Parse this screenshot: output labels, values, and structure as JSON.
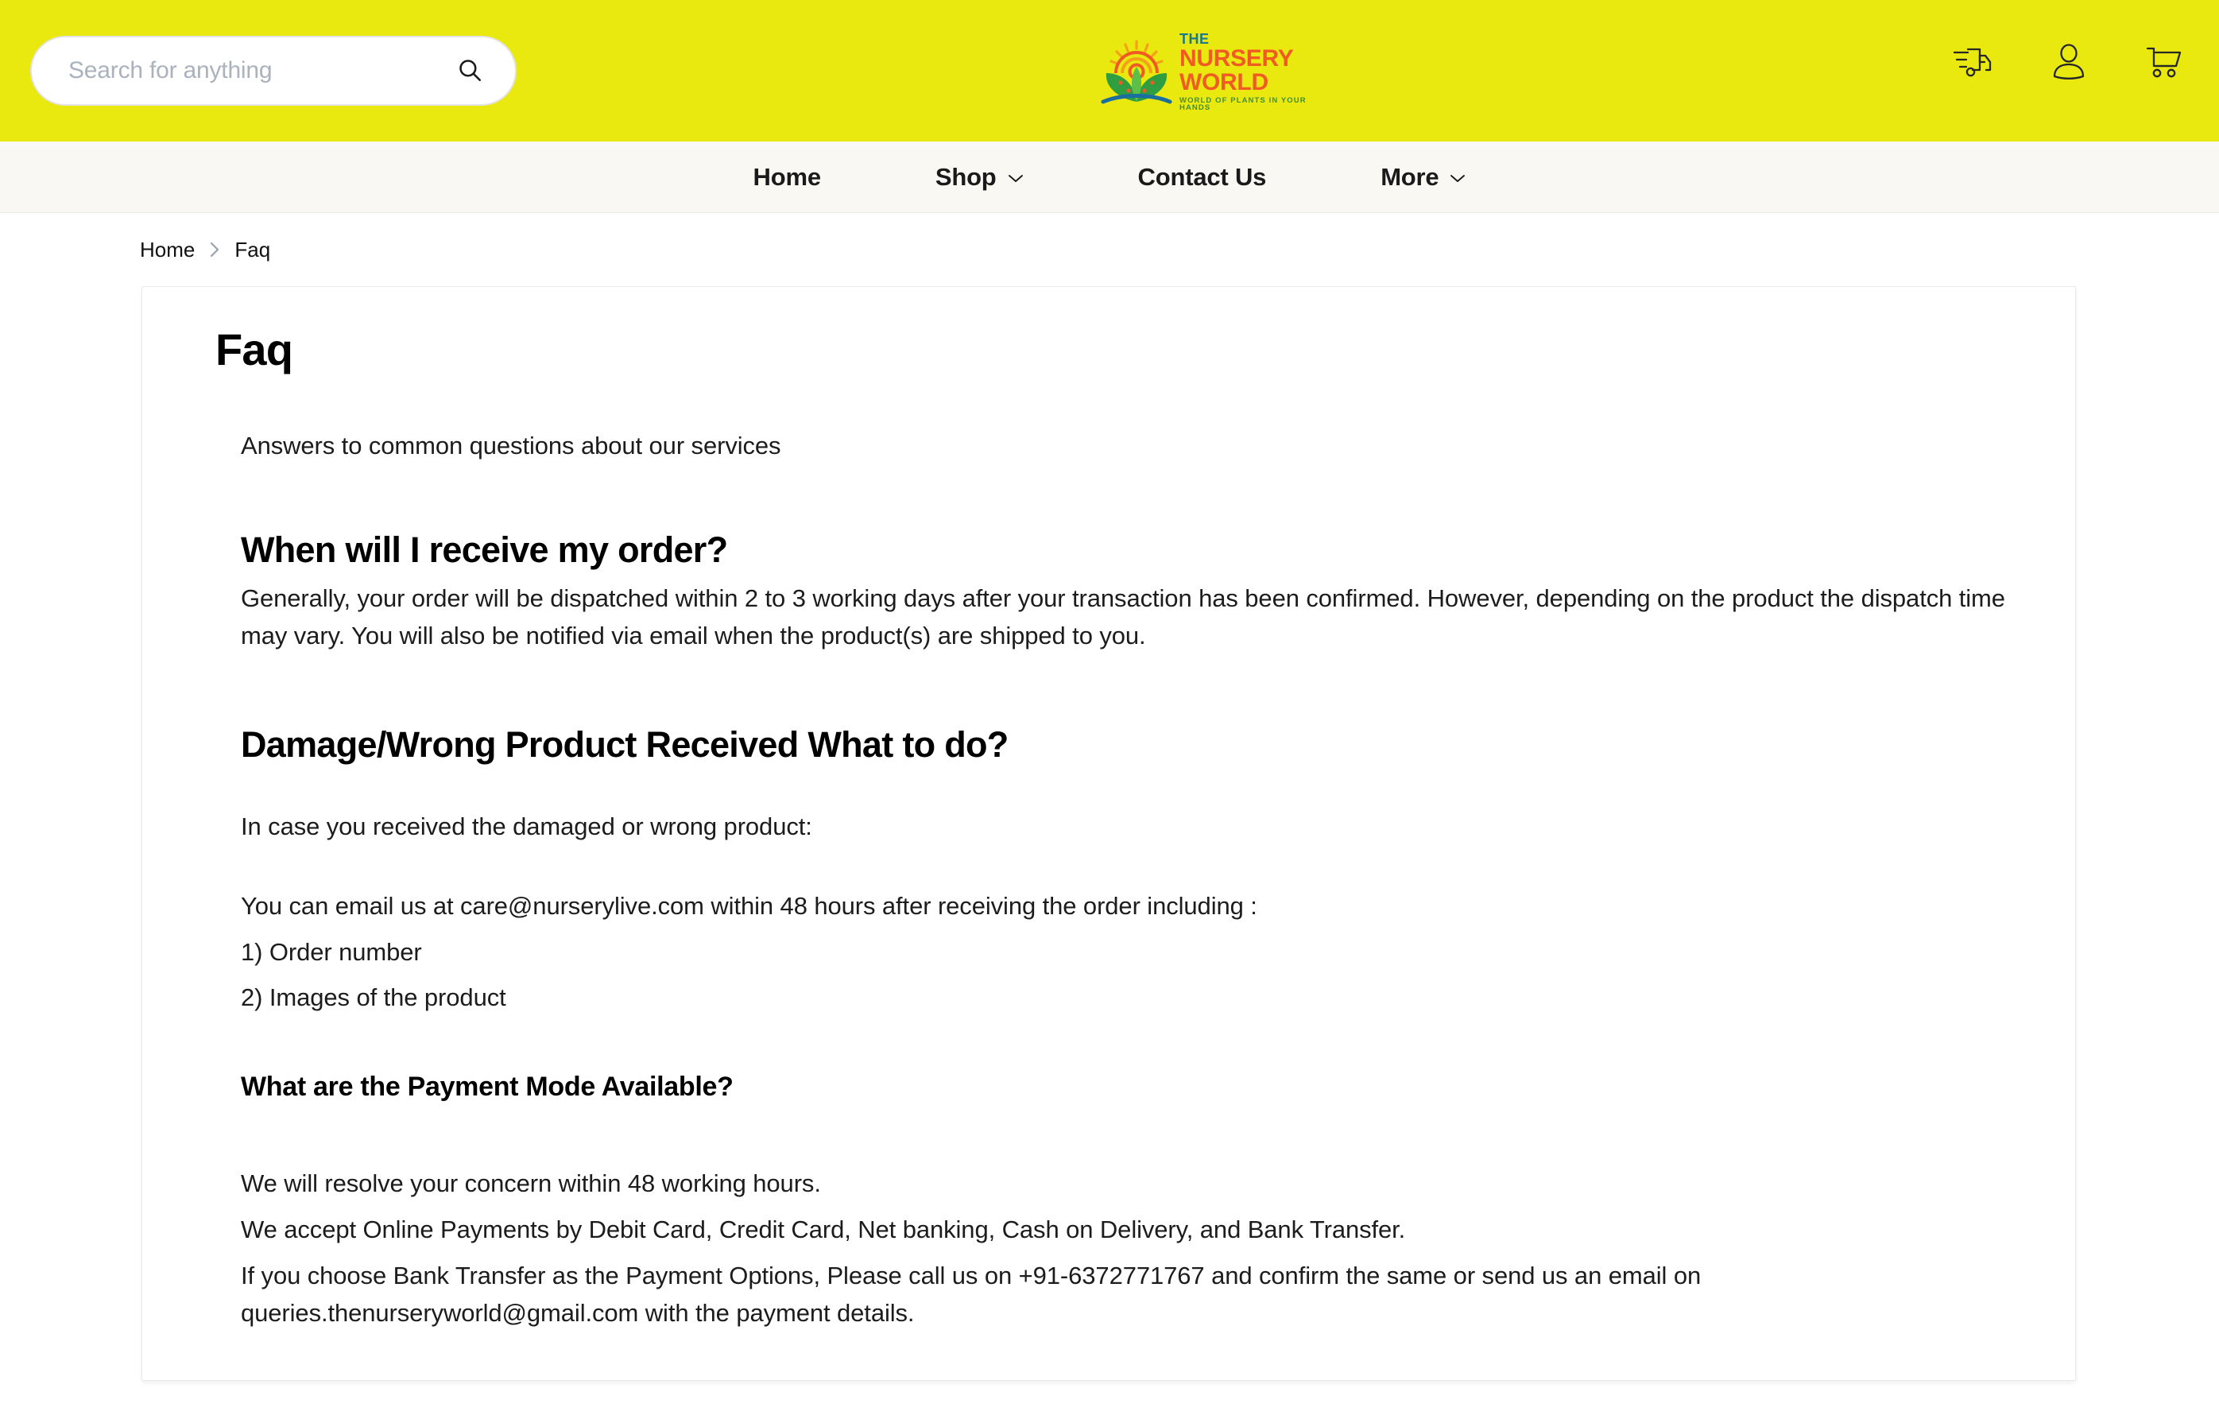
{
  "colors": {
    "header_yellow": "#e9e80f",
    "nav_background": "#f9f8f3",
    "logo_orange": "#f15a22",
    "logo_teal": "#1a7a8c",
    "logo_green": "#3f8f3a",
    "text_primary": "#111111",
    "placeholder": "#a9b2bd"
  },
  "header": {
    "search": {
      "placeholder": "Search for anything",
      "value": "",
      "icon": "search-icon"
    },
    "logo": {
      "the": "THE",
      "main": "NURSERY WORLD",
      "tagline": "WORLD OF PLANTS IN YOUR HANDS",
      "mark": "sun-and-leaves-icon"
    },
    "icons": [
      {
        "name": "track-order-truck-icon",
        "label": "Track Order"
      },
      {
        "name": "user-account-icon",
        "label": "Account"
      },
      {
        "name": "shopping-cart-icon",
        "label": "Cart"
      }
    ]
  },
  "nav": {
    "items": [
      {
        "label": "Home",
        "has_dropdown": false
      },
      {
        "label": "Shop",
        "has_dropdown": true
      },
      {
        "label": "Contact Us",
        "has_dropdown": false
      },
      {
        "label": "More",
        "has_dropdown": true
      }
    ]
  },
  "breadcrumb": {
    "home": "Home",
    "separator": "chevron-right-icon",
    "current": "Faq"
  },
  "page": {
    "title": "Faq",
    "subtitle": "Answers to common questions about our services",
    "sections": [
      {
        "heading": "When will I receive my order?",
        "heading_level": "h2",
        "paragraph": "Generally, your order will be dispatched within 2 to 3 working days after your transaction has been confirmed. However, depending on the product the dispatch time may vary. You will also be notified via email when the product(s) are shipped to you."
      },
      {
        "heading": "Damage/Wrong Product Received What to do?",
        "heading_level": "h2",
        "paragraph": "In case you received the damaged or wrong product:",
        "lines": [
          "You can email us at care@nurserylive.com within 48 hours after receiving the order including :",
          "1) Order number",
          "2) Images of the product"
        ]
      },
      {
        "heading": "What are the Payment Mode Available?",
        "heading_level": "h3",
        "lines": [
          "We will resolve your concern within 48 working hours.",
          "We accept Online Payments by Debit Card, Credit Card, Net banking, Cash on Delivery, and Bank Transfer.",
          "If you choose Bank Transfer as the Payment Options, Please call us on +91-6372771767 and confirm the same or send us an email on queries.thenurseryworld@gmail.com with the payment details."
        ],
        "contact": {
          "phone": "+91-6372771767",
          "email": "queries.thenurseryworld@gmail.com",
          "support_email": "care@nurserylive.com"
        }
      }
    ]
  }
}
